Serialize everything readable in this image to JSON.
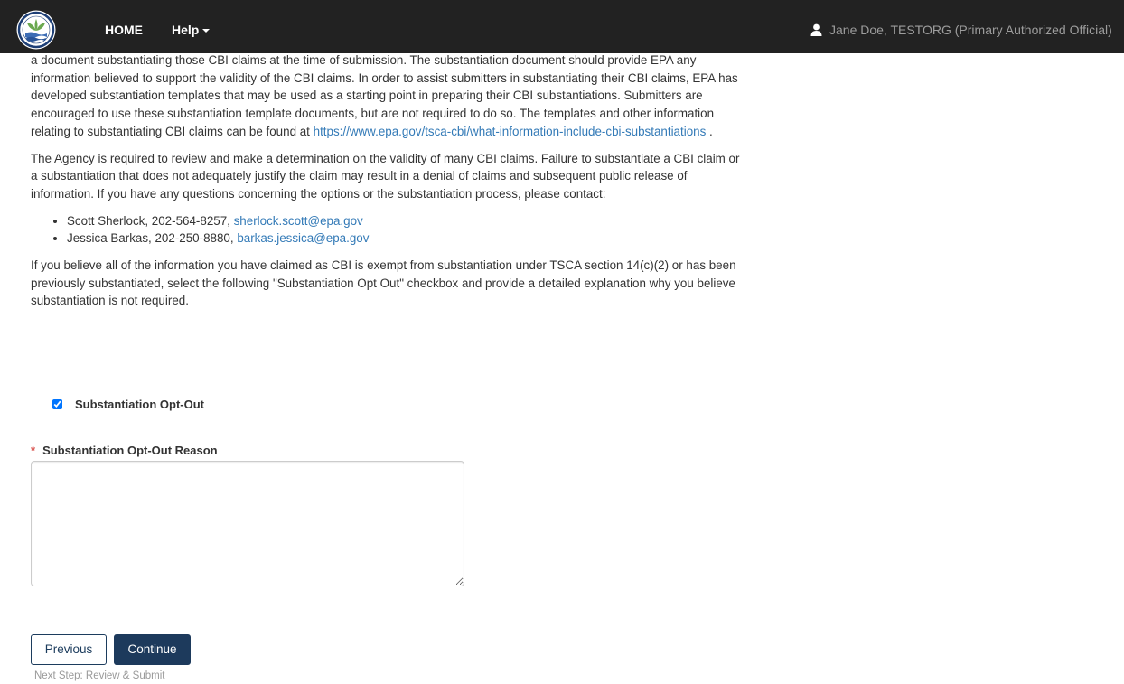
{
  "navbar": {
    "home_label": "HOME",
    "help_label": "Help",
    "user_label": "Jane Doe, TESTORG (Primary Authorized Official)"
  },
  "content": {
    "paragraph1_text": "a document substantiating those CBI claims at the time of submission. The substantiation document should provide EPA any information believed to support the validity of the CBI claims. In order to assist submitters in substantiating their CBI claims, EPA has developed substantiation templates that may be used as a starting point in preparing their CBI substantiations. Submitters are encouraged to use these substantiation template documents, but are not required to do so. The templates and other information relating to substantiating CBI claims can be found at ",
    "paragraph1_link": "https://www.epa.gov/tsca-cbi/what-information-include-cbi-substantiations",
    "paragraph1_end": " .",
    "paragraph2": "The Agency is required to review and make a determination on the validity of many CBI claims. Failure to substantiate a CBI claim or a substantiation that does not adequately justify the claim may result in a denial of claims and subsequent public release of information. If you have any questions concerning the options or the substantiation process, please contact:",
    "contacts": [
      {
        "text": "Scott Sherlock, 202-564-8257, ",
        "email": "sherlock.scott@epa.gov"
      },
      {
        "text": "Jessica Barkas, 202-250-8880, ",
        "email": "barkas.jessica@epa.gov"
      }
    ],
    "paragraph3": "If you believe all of the information you have claimed as CBI is exempt from substantiation under TSCA section 14(c)(2) or has been previously substantiated, select the following \"Substantiation Opt Out\" checkbox and provide a detailed explanation why you believe substantiation is not required."
  },
  "form": {
    "optout_label": "Substantiation Opt-Out",
    "optout_checked": true,
    "required_marker": "*",
    "reason_label": "Substantiation Opt-Out Reason",
    "reason_value": ""
  },
  "actions": {
    "previous_label": "Previous",
    "continue_label": "Continue",
    "next_step_text": "Next Step: Review & Submit"
  },
  "colors": {
    "navbar_bg": "#222222",
    "link": "#337ab7",
    "primary_button": "#1d3a5c",
    "required": "#d9534f"
  }
}
